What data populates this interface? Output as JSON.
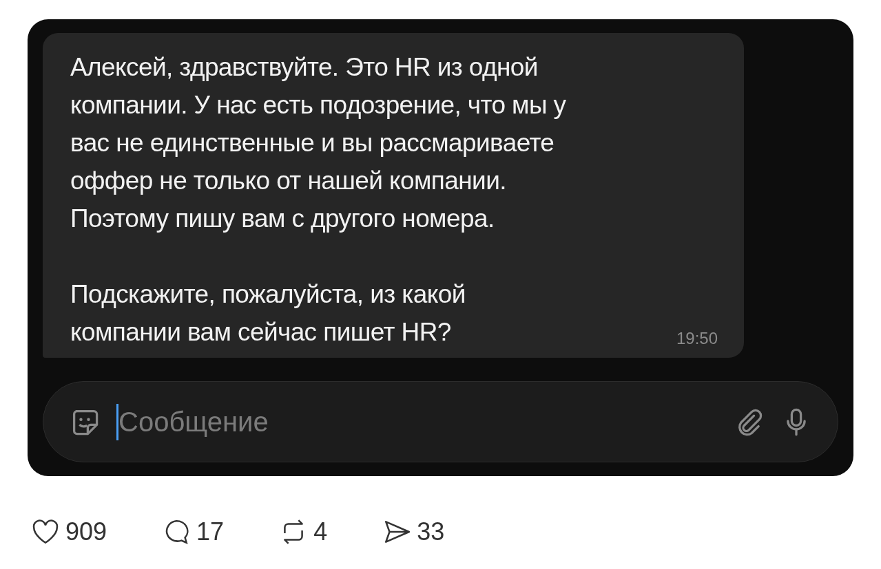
{
  "message": {
    "paragraphs": [
      "Алексей, здравствуйте. Это HR из одной\nкомпании. У нас есть подозрение, что мы у\nвас не единственные и вы рассмариваете\nоффер не только от нашей компании.\nПоэтому пишу вам с другого номера.",
      "Подскажите, пожалуйста, из какой\nкомпании вам сейчас пишет HR?"
    ],
    "time": "19:50"
  },
  "composer": {
    "placeholder": "Сообщение"
  },
  "stats": [
    {
      "kind": "like",
      "count": "909"
    },
    {
      "kind": "reply",
      "count": "17"
    },
    {
      "kind": "repost",
      "count": "4"
    },
    {
      "kind": "share",
      "count": "33"
    }
  ]
}
